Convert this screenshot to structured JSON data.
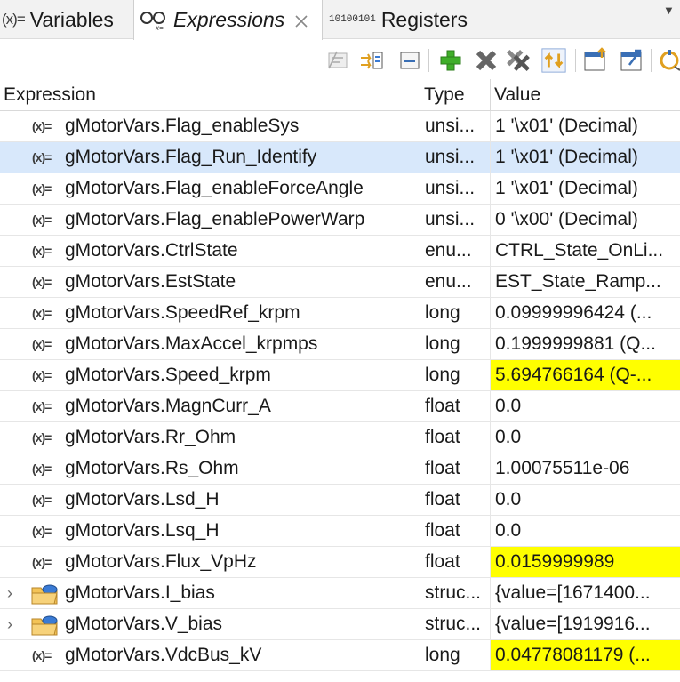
{
  "tabs": [
    {
      "label": "Variables",
      "icon": "variables-icon",
      "icon_text": "(x)=",
      "active": false
    },
    {
      "label": "Expressions",
      "icon": "glasses-icon",
      "active": true
    },
    {
      "label": "Registers",
      "icon": "binary-icon",
      "icon_text_top": "1010",
      "icon_text_bottom": "0101",
      "active": false
    }
  ],
  "toolbar": {
    "buttons": [
      "collapse-all-icon",
      "show-type-names-icon",
      "minimize-icon",
      "add-expression-icon",
      "remove-icon",
      "remove-all-icon",
      "refresh-icon",
      "import-icon",
      "export-icon",
      "continuous-refresh-icon"
    ]
  },
  "columns": {
    "expression": "Expression",
    "type": "Type",
    "value": "Value"
  },
  "colors": {
    "changed_value": "#ffff00",
    "selected_row": "#d8e8fb"
  },
  "rows": [
    {
      "expression": "gMotorVars.Flag_enableSys",
      "type": "unsi...",
      "value": "1 '\\x01' (Decimal)",
      "kind": "variable",
      "changed": false,
      "selected": false
    },
    {
      "expression": "gMotorVars.Flag_Run_Identify",
      "type": "unsi...",
      "value": "1 '\\x01' (Decimal)",
      "kind": "variable",
      "changed": false,
      "selected": true
    },
    {
      "expression": "gMotorVars.Flag_enableForceAngle",
      "type": "unsi...",
      "value": "1 '\\x01' (Decimal)",
      "kind": "variable",
      "changed": false,
      "selected": false
    },
    {
      "expression": "gMotorVars.Flag_enablePowerWarp",
      "type": "unsi...",
      "value": "0 '\\x00' (Decimal)",
      "kind": "variable",
      "changed": false,
      "selected": false
    },
    {
      "expression": "gMotorVars.CtrlState",
      "type": "enu...",
      "value": "CTRL_State_OnLi...",
      "kind": "variable",
      "changed": false,
      "selected": false
    },
    {
      "expression": "gMotorVars.EstState",
      "type": "enu...",
      "value": "EST_State_Ramp...",
      "kind": "variable",
      "changed": false,
      "selected": false
    },
    {
      "expression": "gMotorVars.SpeedRef_krpm",
      "type": "long",
      "value": "0.09999996424 (...",
      "kind": "variable",
      "changed": false,
      "selected": false
    },
    {
      "expression": "gMotorVars.MaxAccel_krpmps",
      "type": "long",
      "value": "0.1999999881 (Q...",
      "kind": "variable",
      "changed": false,
      "selected": false
    },
    {
      "expression": "gMotorVars.Speed_krpm",
      "type": "long",
      "value": "5.694766164 (Q-...",
      "kind": "variable",
      "changed": true,
      "selected": false
    },
    {
      "expression": "gMotorVars.MagnCurr_A",
      "type": "float",
      "value": "0.0",
      "kind": "variable",
      "changed": false,
      "selected": false
    },
    {
      "expression": "gMotorVars.Rr_Ohm",
      "type": "float",
      "value": "0.0",
      "kind": "variable",
      "changed": false,
      "selected": false
    },
    {
      "expression": "gMotorVars.Rs_Ohm",
      "type": "float",
      "value": "1.00075511e-06",
      "kind": "variable",
      "changed": false,
      "selected": false
    },
    {
      "expression": "gMotorVars.Lsd_H",
      "type": "float",
      "value": "0.0",
      "kind": "variable",
      "changed": false,
      "selected": false
    },
    {
      "expression": "gMotorVars.Lsq_H",
      "type": "float",
      "value": "0.0",
      "kind": "variable",
      "changed": false,
      "selected": false
    },
    {
      "expression": "gMotorVars.Flux_VpHz",
      "type": "float",
      "value": "0.0159999989",
      "kind": "variable",
      "changed": true,
      "selected": false
    },
    {
      "expression": "gMotorVars.I_bias",
      "type": "struc...",
      "value": "{value=[1671400...",
      "kind": "struct",
      "changed": false,
      "selected": false
    },
    {
      "expression": "gMotorVars.V_bias",
      "type": "struc...",
      "value": "{value=[1919916...",
      "kind": "struct",
      "changed": false,
      "selected": false
    },
    {
      "expression": "gMotorVars.VdcBus_kV",
      "type": "long",
      "value": "0.04778081179 (...",
      "kind": "variable",
      "changed": true,
      "selected": false
    }
  ]
}
